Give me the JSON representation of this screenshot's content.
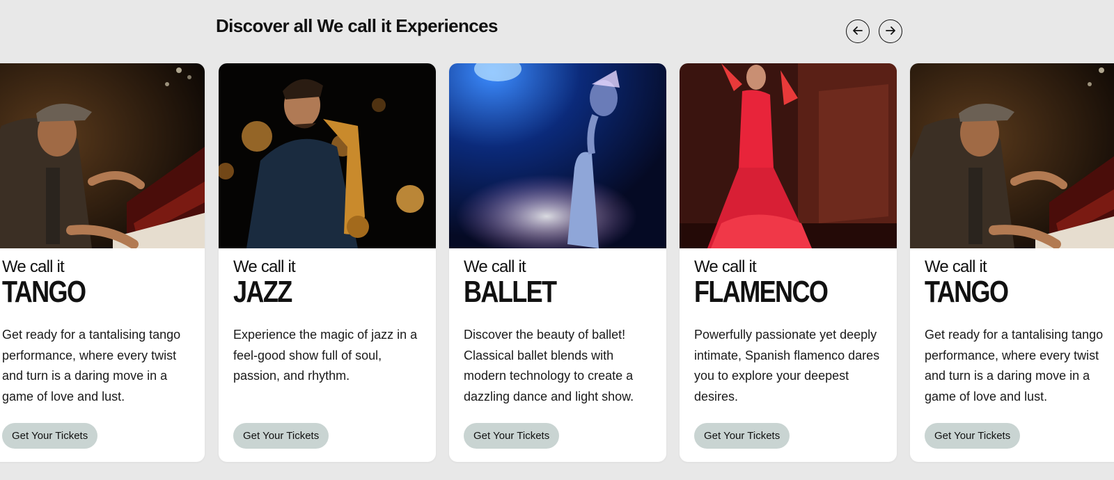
{
  "section": {
    "title": "Discover all We call it Experiences"
  },
  "nav": {
    "prev_icon": "arrow-left-icon",
    "next_icon": "arrow-right-icon"
  },
  "cards": [
    {
      "prefix": "We call it",
      "genre": "TANGO",
      "description": "Get ready for a tantalising tango performance, where every twist and turn is a daring move in a game of love and lust.",
      "button": "Get Your Tickets",
      "image": "pianist-photo"
    },
    {
      "prefix": "We call it",
      "genre": "JAZZ",
      "description": "Experience the magic of jazz in a feel-good show full of soul, passion, and rhythm.",
      "button": "Get Your Tickets",
      "image": "saxophonist-photo"
    },
    {
      "prefix": "We call it",
      "genre": "BALLET",
      "description": "Discover the beauty of ballet! Classical ballet blends with modern technology to create a dazzling dance and light show.",
      "button": "Get Your Tickets",
      "image": "ballerina-photo"
    },
    {
      "prefix": "We call it",
      "genre": "FLAMENCO",
      "description": "Powerfully passionate yet deeply intimate, Spanish flamenco dares you to explore your deepest desires.",
      "button": "Get Your Tickets",
      "image": "flamenco-dancer-photo"
    },
    {
      "prefix": "We call it",
      "genre": "TANGO",
      "description": "Get ready for a tantalising tango performance, where every twist and turn is a daring move in a game of love and lust.",
      "button": "Get Your Tickets",
      "image": "pianist-photo"
    }
  ]
}
